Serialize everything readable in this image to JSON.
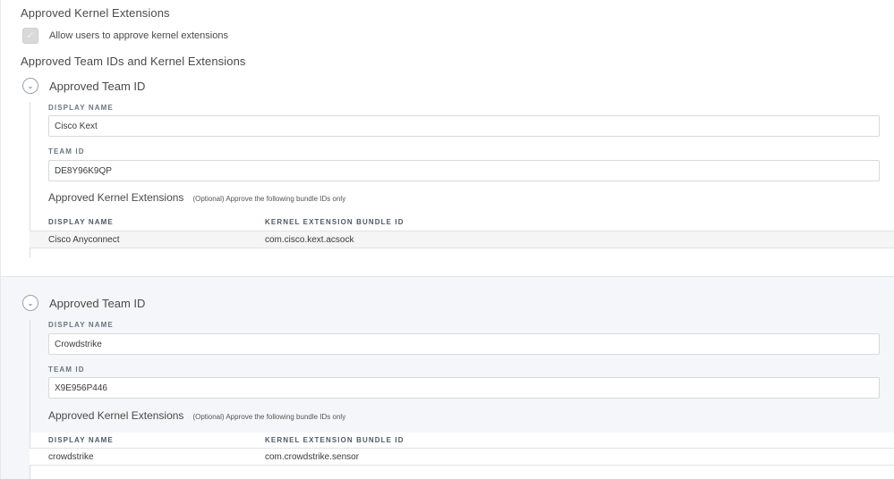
{
  "section_title": "Approved Kernel Extensions",
  "allow_checkbox": {
    "label": "Allow users to approve kernel extensions",
    "checked": true,
    "check_glyph": "✓"
  },
  "teams_section_title": "Approved Team IDs and Kernel Extensions",
  "teams": [
    {
      "title": "Approved Team ID",
      "display_name_label": "DISPLAY NAME",
      "display_name_value": "Cisco Kext",
      "team_id_label": "TEAM ID",
      "team_id_value": "DE8Y96K9QP",
      "ke_title": "Approved Kernel Extensions",
      "ke_note": "(Optional) Approve the following bundle IDs only",
      "columns": [
        "DISPLAY NAME",
        "KERNEL EXTENSION BUNDLE ID"
      ],
      "rows": [
        {
          "name": "Cisco Anyconnect",
          "bundle_id": "com.cisco.kext.acsock"
        }
      ]
    },
    {
      "title": "Approved Team ID",
      "display_name_label": "DISPLAY NAME",
      "display_name_value": "Crowdstrike",
      "team_id_label": "TEAM ID",
      "team_id_value": "X9E956P446",
      "ke_title": "Approved Kernel Extensions",
      "ke_note": "(Optional) Approve the following bundle IDs only",
      "columns": [
        "DISPLAY NAME",
        "KERNEL EXTENSION BUNDLE ID"
      ],
      "rows": [
        {
          "name": "crowdstrike",
          "bundle_id": "com.crowdstrike.sensor"
        }
      ]
    }
  ],
  "icons": {
    "collapse": "chevron-down-icon",
    "checkbox": "checkmark-icon"
  },
  "colors": {
    "alt_background": "#f4f6f9",
    "checkbox_fill": "#d9d9d9"
  }
}
